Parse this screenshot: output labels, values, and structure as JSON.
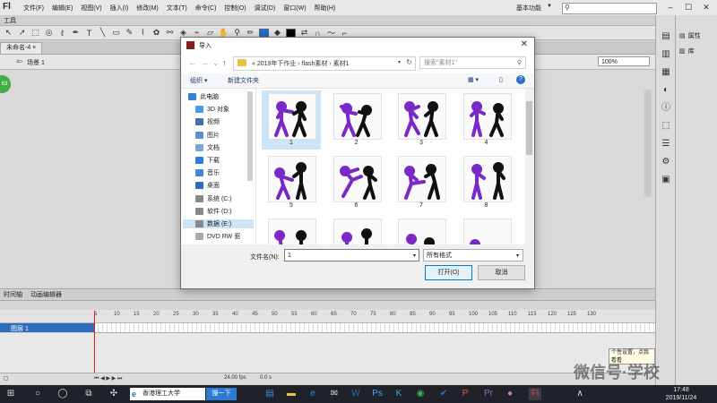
{
  "app": {
    "logo": "Fl",
    "menu": [
      "文件(F)",
      "编辑(E)",
      "视图(V)",
      "插入(I)",
      "修改(M)",
      "文本(T)",
      "命令(C)",
      "控制(O)",
      "调试(D)",
      "窗口(W)",
      "帮助(H)"
    ],
    "workspace": "基本功能",
    "toolbar_title": "工具",
    "doc_tab": "未命名-4 ×",
    "scene": "场景 1",
    "zoom": "100%",
    "badge": "63"
  },
  "right_panel": {
    "properties": "属性",
    "library": "库"
  },
  "timeline": {
    "tab_timeline": "时间轴",
    "tab_motion": "动画编辑器",
    "ruler": [
      "5",
      "10",
      "15",
      "20",
      "25",
      "30",
      "35",
      "40",
      "45",
      "50",
      "55",
      "60",
      "65",
      "70",
      "75",
      "80",
      "85",
      "90",
      "95",
      "100",
      "105",
      "110",
      "115",
      "120",
      "125",
      "130"
    ],
    "layer_name": "图层 1",
    "fps": "24.00 fps",
    "time": "0.0 s"
  },
  "tooltip": "个性设置，点我看看",
  "watermark": "微信号·学校",
  "taskbar": {
    "address": "香港理工大学",
    "next": "搜一下",
    "time": "17:48",
    "date": "2019/11/24"
  },
  "dialog": {
    "title": "导入",
    "path": "«  2019年下作业  ›  flash素材  ›  素材1",
    "search_placeholder": "搜索\"素材1\"",
    "organize": "组织 ▾",
    "new_folder": "新建文件夹",
    "nav": [
      {
        "label": "此电脑",
        "color": "#3b7fd0"
      },
      {
        "label": "3D 对象",
        "color": "#4a9de0"
      },
      {
        "label": "视频",
        "color": "#4a6fa5"
      },
      {
        "label": "图片",
        "color": "#5a8fd0"
      },
      {
        "label": "文档",
        "color": "#7aa7de"
      },
      {
        "label": "下载",
        "color": "#2f7fd7"
      },
      {
        "label": "音乐",
        "color": "#3d88d9"
      },
      {
        "label": "桌面",
        "color": "#2d6bbf"
      },
      {
        "label": "系统 (C:)",
        "color": "#888"
      },
      {
        "label": "软件 (D:)",
        "color": "#888"
      },
      {
        "label": "数据 (E:)",
        "color": "#888"
      },
      {
        "label": "DVD RW 驱",
        "color": "#aaa"
      }
    ],
    "files": [
      "1",
      "2",
      "3",
      "4",
      "5",
      "6",
      "7",
      "8",
      "",
      "",
      "",
      ""
    ],
    "filename_label": "文件名(N):",
    "filename_value": "1",
    "filetype": "所有格式",
    "open": "打开(O)",
    "cancel": "取消"
  }
}
